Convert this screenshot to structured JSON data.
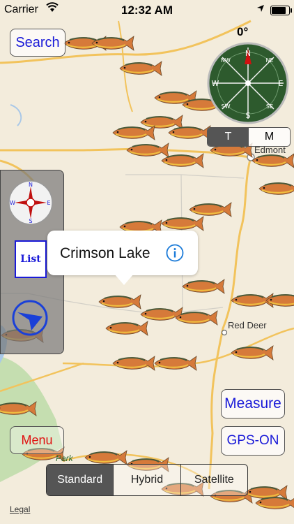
{
  "status_bar": {
    "carrier": "Carrier",
    "time": "12:32 AM",
    "battery_level": 0.9
  },
  "search": {
    "label": "Search"
  },
  "compass": {
    "heading": "0°",
    "letters": [
      "N",
      "NE",
      "E",
      "SE",
      "S",
      "SW",
      "W",
      "NW"
    ]
  },
  "north_toggle": {
    "options": [
      "T",
      "M"
    ],
    "selected": "T"
  },
  "map_labels": {
    "city_edmonton": "Edmont",
    "city_red_deer": "Red Deer",
    "park": "Park",
    "legal": "Legal"
  },
  "side_panel": {
    "compass_letters": [
      "N",
      "E",
      "S",
      "W"
    ],
    "list_label": "List"
  },
  "callout": {
    "title": "Crimson Lake"
  },
  "buttons": {
    "measure": "Measure",
    "gps": "GPS-ON",
    "menu": "Menu"
  },
  "map_type": {
    "options": [
      "Standard",
      "Hybrid",
      "Satellite"
    ],
    "selected": "Standard"
  },
  "colors": {
    "map_bg": "#f3ecdc",
    "road": "#f2c35c",
    "water": "#a9c8e8",
    "park": "#c5deb0",
    "accent": "#1a1ad8",
    "menu": "#e01010"
  },
  "marker_icon": "trout-fish-icon"
}
